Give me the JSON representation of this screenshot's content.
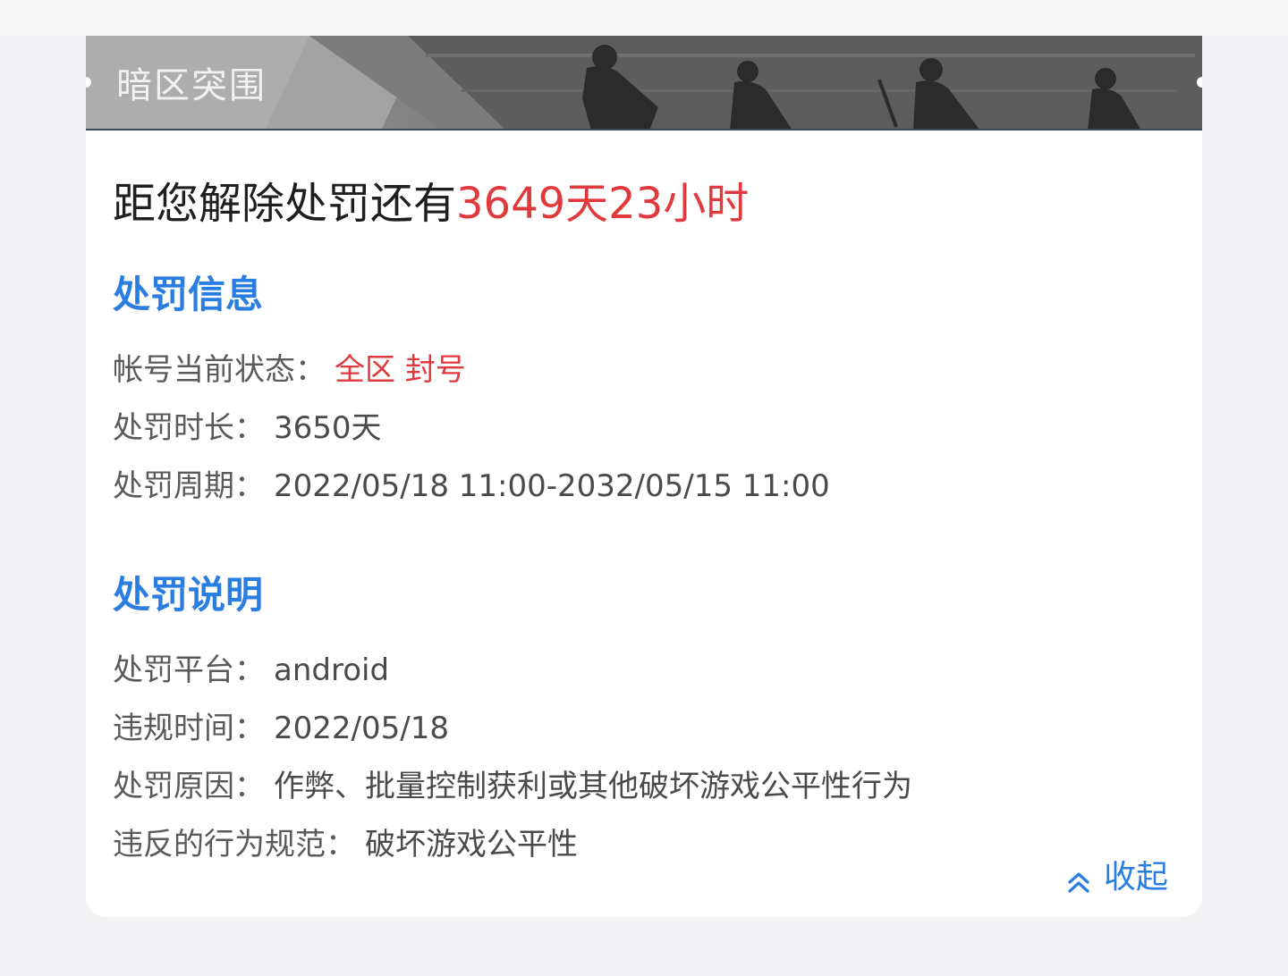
{
  "banner": {
    "title": "暗区突围"
  },
  "countdown": {
    "prefix": "距您解除处罚还有",
    "remaining": "3649天23小时"
  },
  "penalty_info": {
    "title": "处罚信息",
    "rows": [
      {
        "label": "帐号当前状态：",
        "value": "全区 封号"
      },
      {
        "label": "处罚时长：",
        "value": "3650天"
      },
      {
        "label": "处罚周期：",
        "value": "2022/05/18 11:00-2032/05/15 11:00"
      }
    ]
  },
  "penalty_desc": {
    "title": "处罚说明",
    "rows": [
      {
        "label": "处罚平台：",
        "value": "android"
      },
      {
        "label": "违规时间：",
        "value": "2022/05/18"
      },
      {
        "label": "处罚原因：",
        "value": "作弊、批量控制获利或其他破坏游戏公平性行为"
      },
      {
        "label": "违反的行为规范：",
        "value": "破坏游戏公平性"
      }
    ]
  },
  "collapse": {
    "label": "收起",
    "icon": "double-chevron-up-icon"
  },
  "colors": {
    "accent": "#2a7de1",
    "highlight": "#e0393e"
  }
}
